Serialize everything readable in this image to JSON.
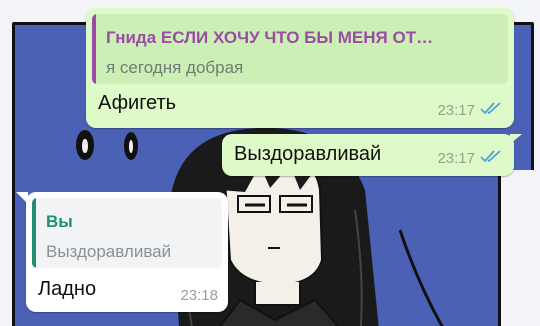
{
  "chat": {
    "messages": [
      {
        "direction": "outgoing",
        "reply": {
          "author": "Гнида ЕСЛИ ХОЧУ ЧТО БЫ МЕНЯ ОТ…",
          "text": "я сегодня добрая",
          "author_color": "#9a4ea3"
        },
        "text": "Афигеть",
        "time": "23:17",
        "status": "read"
      },
      {
        "direction": "outgoing",
        "text": "Выздоравливай",
        "time": "23:17",
        "status": "read"
      },
      {
        "direction": "incoming",
        "reply": {
          "author": "Вы",
          "text": "Выздоравливай",
          "author_color": "#1d8f72"
        },
        "text": "Ладно",
        "time": "23:18"
      }
    ]
  },
  "colors": {
    "outgoing_bubble": "#dffac9",
    "incoming_bubble": "#ffffff",
    "read_ticks": "#4aa3e0",
    "wallpaper_blue": "#4a61b6"
  },
  "icons": {
    "read_status": "double-check-icon"
  }
}
